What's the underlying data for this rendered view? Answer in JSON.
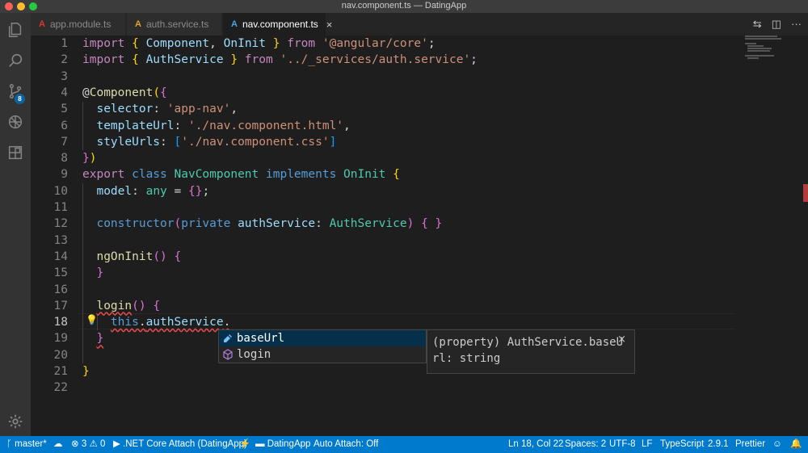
{
  "window": {
    "title": "nav.component.ts — DatingApp"
  },
  "activity_bar": {
    "items": [
      {
        "name": "explorer-icon"
      },
      {
        "name": "search-icon"
      },
      {
        "name": "source-control-icon",
        "badge": "8"
      },
      {
        "name": "debug-icon"
      },
      {
        "name": "extensions-icon"
      }
    ],
    "settings_icon": "gear-icon"
  },
  "tabs": [
    {
      "label": "app.module.ts",
      "icon": "A",
      "icon_color": "#dd3333"
    },
    {
      "label": "auth.service.ts",
      "icon": "A",
      "icon_color": "#e0a526"
    },
    {
      "label": "nav.component.ts",
      "icon": "A",
      "icon_color": "#4aa3df",
      "close": "×",
      "active": true
    }
  ],
  "editor": {
    "line_numbers": [
      "1",
      "2",
      "3",
      "4",
      "5",
      "6",
      "7",
      "8",
      "9",
      "10",
      "11",
      "12",
      "13",
      "14",
      "15",
      "16",
      "17",
      "18",
      "19",
      "20",
      "21",
      "22"
    ],
    "current_line": "18",
    "lines": [
      [
        {
          "t": "import ",
          "c": "kw2"
        },
        {
          "t": "{ ",
          "c": "br1"
        },
        {
          "t": "Component",
          "c": "var"
        },
        {
          "t": ", "
        },
        {
          "t": "OnInit",
          "c": "var"
        },
        {
          "t": " }",
          "c": "br1"
        },
        {
          "t": " from ",
          "c": "kw2"
        },
        {
          "t": "'@angular/core'",
          "c": "str"
        },
        {
          "t": ";"
        }
      ],
      [
        {
          "t": "import ",
          "c": "kw2"
        },
        {
          "t": "{ ",
          "c": "br1"
        },
        {
          "t": "AuthService",
          "c": "var"
        },
        {
          "t": " }",
          "c": "br1"
        },
        {
          "t": " from ",
          "c": "kw2"
        },
        {
          "t": "'../_services/auth.service'",
          "c": "str"
        },
        {
          "t": ";"
        }
      ],
      [],
      [
        {
          "t": "@",
          "c": ""
        },
        {
          "t": "Component",
          "c": "fn"
        },
        {
          "t": "(",
          "c": "br1"
        },
        {
          "t": "{",
          "c": "br2"
        }
      ],
      [
        {
          "t": "  "
        },
        {
          "t": "selector",
          "c": "var"
        },
        {
          "t": ": "
        },
        {
          "t": "'app-nav'",
          "c": "str"
        },
        {
          "t": ","
        }
      ],
      [
        {
          "t": "  "
        },
        {
          "t": "templateUrl",
          "c": "var"
        },
        {
          "t": ": "
        },
        {
          "t": "'./nav.component.html'",
          "c": "str"
        },
        {
          "t": ","
        }
      ],
      [
        {
          "t": "  "
        },
        {
          "t": "styleUrls",
          "c": "var"
        },
        {
          "t": ": "
        },
        {
          "t": "[",
          "c": "br3"
        },
        {
          "t": "'./nav.component.css'",
          "c": "str"
        },
        {
          "t": "]",
          "c": "br3"
        }
      ],
      [
        {
          "t": "}",
          "c": "br2"
        },
        {
          "t": ")",
          "c": "br1"
        }
      ],
      [
        {
          "t": "export ",
          "c": "kw2"
        },
        {
          "t": "class ",
          "c": "kw"
        },
        {
          "t": "NavComponent ",
          "c": "ty"
        },
        {
          "t": "implements ",
          "c": "kw"
        },
        {
          "t": "OnInit ",
          "c": "ty"
        },
        {
          "t": "{",
          "c": "br1"
        }
      ],
      [
        {
          "t": "  "
        },
        {
          "t": "model",
          "c": "var"
        },
        {
          "t": ": "
        },
        {
          "t": "any",
          "c": "ty"
        },
        {
          "t": " = "
        },
        {
          "t": "{}",
          "c": "br2"
        },
        {
          "t": ";"
        }
      ],
      [],
      [
        {
          "t": "  "
        },
        {
          "t": "constructor",
          "c": "kw"
        },
        {
          "t": "(",
          "c": "br2"
        },
        {
          "t": "private ",
          "c": "kw"
        },
        {
          "t": "authService",
          "c": "var"
        },
        {
          "t": ": "
        },
        {
          "t": "AuthService",
          "c": "ty"
        },
        {
          "t": ")",
          "c": "br2"
        },
        {
          "t": " "
        },
        {
          "t": "{ }",
          "c": "br2"
        }
      ],
      [],
      [
        {
          "t": "  "
        },
        {
          "t": "ngOnInit",
          "c": "fn"
        },
        {
          "t": "()",
          "c": "br2"
        },
        {
          "t": " "
        },
        {
          "t": "{",
          "c": "br2"
        }
      ],
      [
        {
          "t": "  "
        },
        {
          "t": "}",
          "c": "br2"
        }
      ],
      [],
      [
        {
          "t": "  "
        },
        {
          "t": "login",
          "c": "fn"
        },
        {
          "t": "()",
          "c": "br2"
        },
        {
          "t": " "
        },
        {
          "t": "{",
          "c": "br2"
        }
      ],
      [
        {
          "t": "    "
        },
        {
          "t": "this",
          "c": "kw"
        },
        {
          "t": "."
        },
        {
          "t": "authService",
          "c": "var"
        },
        {
          "t": "."
        }
      ],
      [
        {
          "t": "  "
        },
        {
          "t": "}",
          "c": "br2"
        }
      ],
      [],
      [
        {
          "t": "}",
          "c": "br1"
        }
      ],
      []
    ]
  },
  "suggest": {
    "items": [
      {
        "label": "baseUrl",
        "kind": "property",
        "selected": true
      },
      {
        "label": "login",
        "kind": "method"
      }
    ],
    "details": [
      "(property) AuthService.baseU",
      "rl: string"
    ],
    "close": "×"
  },
  "status_bar": {
    "branch": "master*",
    "errors": "3",
    "warnings": "0",
    "debug": ".NET Core Attach (DatingApp)",
    "folder": "DatingApp",
    "auto_attach": "Auto Attach: Off",
    "position": "Ln 18, Col 22",
    "spaces": "Spaces: 2",
    "encoding": "UTF-8",
    "eol": "LF",
    "language": "TypeScript",
    "version": "2.9.1",
    "formatter": "Prettier"
  },
  "colors": {
    "status_bar": "#007acc",
    "editor_bg": "#1e1e1e",
    "activity_bar": "#333333"
  }
}
